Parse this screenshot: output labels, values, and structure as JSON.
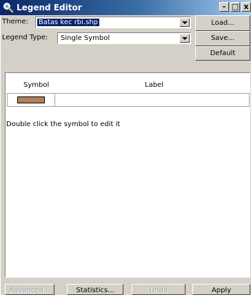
{
  "window": {
    "title": "Legend Editor",
    "icon": "search-icon",
    "minimize_glyph": "-",
    "maximize_glyph": "□",
    "close_glyph": "x"
  },
  "theme": {
    "label": "Theme:",
    "value": "Batas kec rbi.shp"
  },
  "legend_type": {
    "label": "Legend Type:",
    "value": "Single Symbol"
  },
  "side_buttons": {
    "load": "Load...",
    "save": "Save...",
    "default": "Default"
  },
  "table": {
    "symbol_header": "Symbol",
    "label_header": "Label",
    "rows": [
      {
        "symbol_color": "#b0805a",
        "label": ""
      }
    ]
  },
  "hint": "Double click the symbol to edit it",
  "bottom_buttons": {
    "advanced": "Advanced...",
    "statistics": "Statistics...",
    "undo": "Undo",
    "apply": "Apply"
  },
  "colors": {
    "titlebar_start": "#0a246a",
    "face": "#d4d0c8",
    "selection": "#0a246a"
  }
}
